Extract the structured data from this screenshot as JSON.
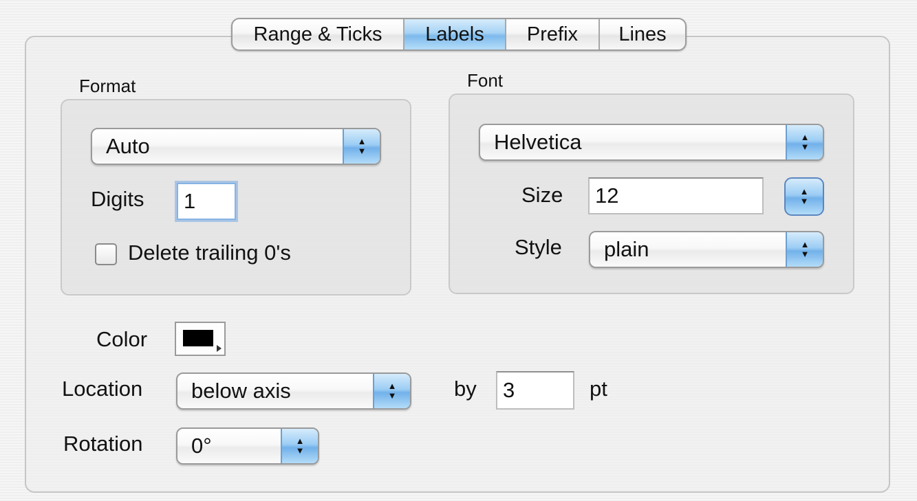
{
  "tabs": [
    {
      "label": "Range & Ticks",
      "selected": false
    },
    {
      "label": "Labels",
      "selected": true
    },
    {
      "label": "Prefix",
      "selected": false
    },
    {
      "label": "Lines",
      "selected": false
    }
  ],
  "format": {
    "group_label": "Format",
    "popup_value": "Auto",
    "digits_label": "Digits",
    "digits_value": "1",
    "delete_trailing_label": "Delete trailing 0's",
    "delete_trailing_checked": false
  },
  "font": {
    "group_label": "Font",
    "family_value": "Helvetica",
    "size_label": "Size",
    "size_value": "12",
    "style_label": "Style",
    "style_value": "plain"
  },
  "color": {
    "label": "Color",
    "value": "#000000"
  },
  "location": {
    "label": "Location",
    "value": "below axis",
    "by_label": "by",
    "by_value": "3",
    "unit": "pt"
  },
  "rotation": {
    "label": "Rotation",
    "value": "0°"
  },
  "icons": {
    "popup_arrows": "up-down-arrows-icon",
    "color_menu": "disclosure-triangle-icon"
  },
  "colors": {
    "accent_blue": "#7db9ec",
    "panel_border": "#c5c5c5"
  }
}
